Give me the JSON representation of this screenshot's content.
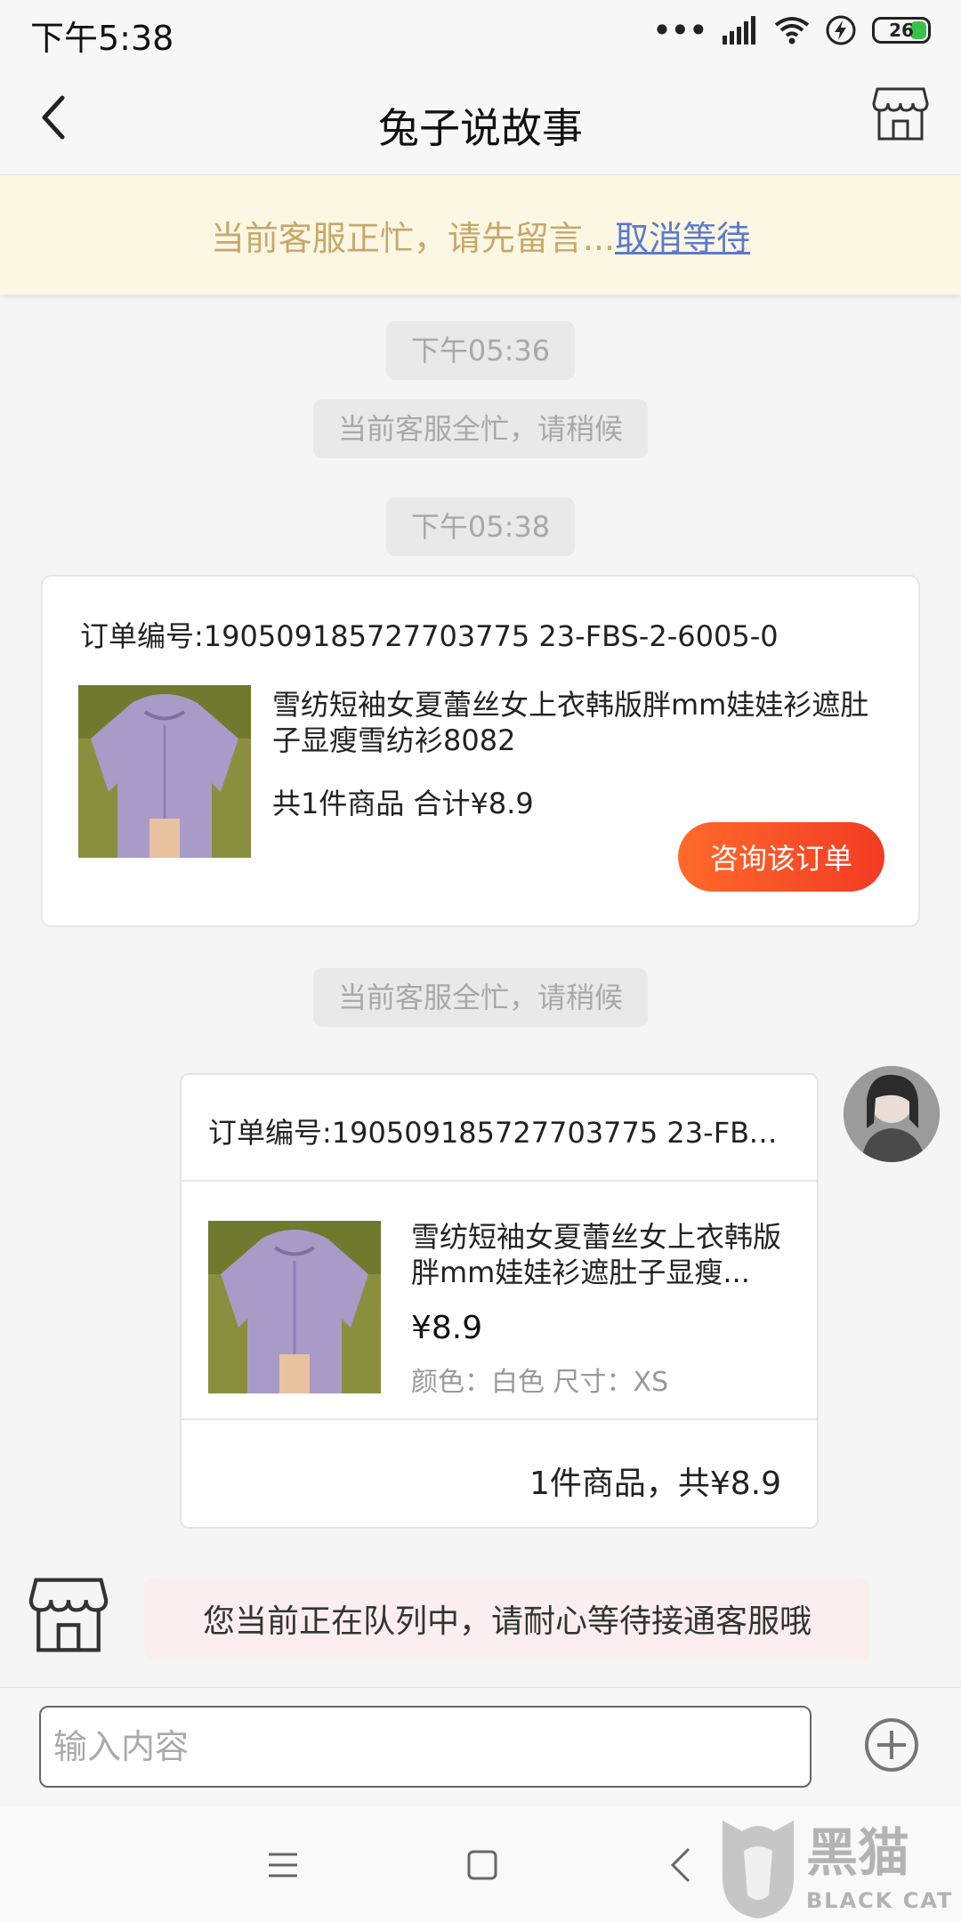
{
  "status_bar": {
    "time": "下午5:38",
    "battery": "26"
  },
  "header": {
    "title": "兔子说故事"
  },
  "notice": {
    "text": "当前客服正忙，请先留言...",
    "link": "取消等待"
  },
  "timeline": {
    "time1": "下午05:36",
    "system1": "当前客服全忙，请稍候",
    "time2": "下午05:38",
    "system2": "当前客服全忙，请稍候"
  },
  "order_card": {
    "order_no": "订单编号:190509185727703775 23-FBS-2-6005-0",
    "product_name": "雪纺短袖女夏蕾丝女上衣韩版胖mm娃娃衫遮肚子显瘦雪纺衫8082",
    "total": "共1件商品 合计¥8.9",
    "consult_button": "咨询该订单"
  },
  "sent_card": {
    "order_no": "订单编号:190509185727703775 23-FBS-2-...",
    "product_name": "雪纺短袖女夏蕾丝女上衣韩版胖mm娃娃衫遮肚子显瘦...",
    "price": "¥8.9",
    "spec": "颜色：白色  尺寸：XS",
    "summary": "1件商品，共¥8.9"
  },
  "queue_message": "您当前正在队列中，请耐心等待接通客服哦",
  "input": {
    "placeholder": "输入内容"
  },
  "watermark": {
    "brand_cn": "黑猫",
    "brand_en": "BLACK CAT"
  },
  "colors": {
    "accent": "#f23b24",
    "notice_bg": "#fcf7e3",
    "notice_text": "#c6a86a",
    "link": "#5c79cc"
  }
}
